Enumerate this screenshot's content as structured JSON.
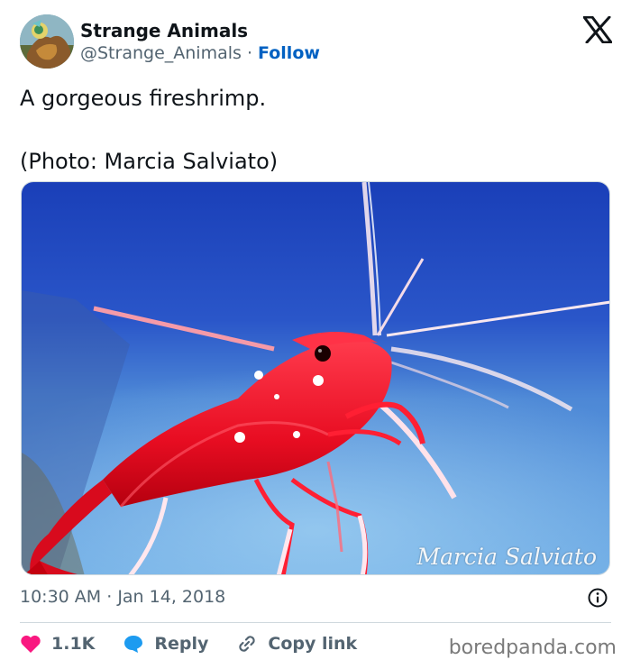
{
  "author": {
    "name": "Strange Animals",
    "handle": "@Strange_Animals",
    "separator": " · ",
    "follow_label": "Follow"
  },
  "tweet": {
    "lines": [
      "A gorgeous fireshrimp.",
      "(Photo: Marcia Salviato)"
    ]
  },
  "media": {
    "watermark": "Marcia Salviato"
  },
  "meta": {
    "time": "10:30 AM",
    "dot": " · ",
    "date": "Jan 14, 2018"
  },
  "actions": {
    "likes": "1.1K",
    "reply_label": "Reply",
    "copy_label": "Copy link"
  },
  "source": "boredpanda.com",
  "icons": [
    "x-logo-icon",
    "info-icon",
    "heart-icon",
    "reply-bubble-icon",
    "link-icon"
  ],
  "colors": {
    "follow": "#0061c2",
    "like": "#f91880",
    "reply": "#1d9bf0",
    "muted": "#536471"
  }
}
